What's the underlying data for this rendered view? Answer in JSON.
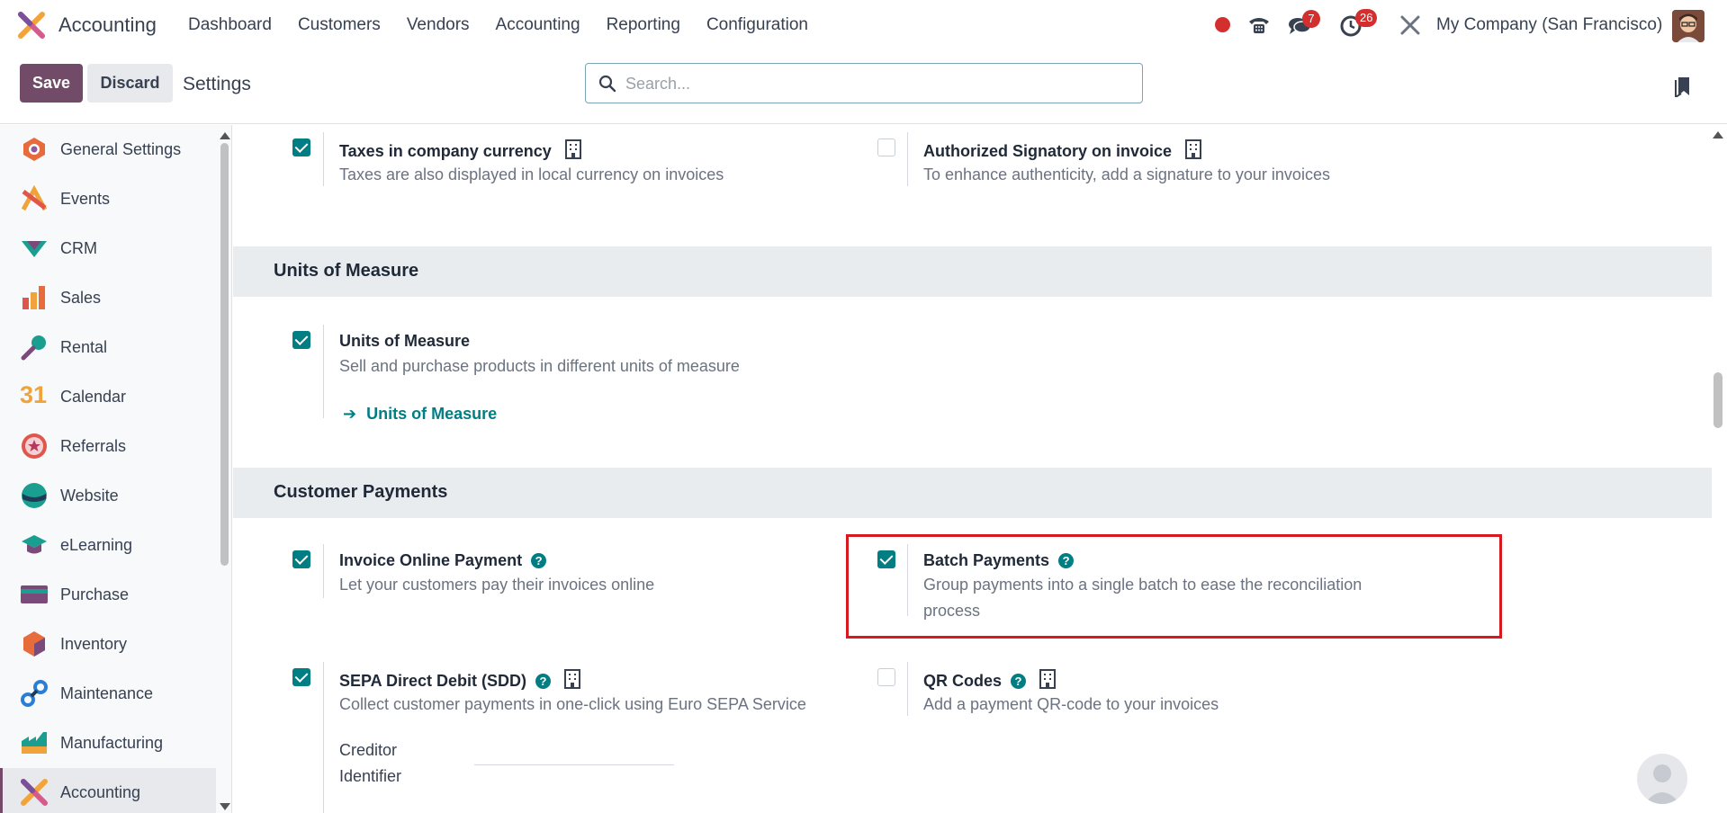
{
  "topbar": {
    "app_name": "Accounting",
    "menu": [
      "Dashboard",
      "Customers",
      "Vendors",
      "Accounting",
      "Reporting",
      "Configuration"
    ],
    "messages_count": "7",
    "activities_count": "26",
    "company": "My Company (San Francisco)"
  },
  "controlbar": {
    "save_label": "Save",
    "discard_label": "Discard",
    "breadcrumb": "Settings",
    "search_placeholder": "Search..."
  },
  "sidebar": {
    "items": [
      {
        "label": "General Settings",
        "icon": "general-settings-icon"
      },
      {
        "label": "Events",
        "icon": "events-icon"
      },
      {
        "label": "CRM",
        "icon": "crm-icon"
      },
      {
        "label": "Sales",
        "icon": "sales-icon"
      },
      {
        "label": "Rental",
        "icon": "rental-icon"
      },
      {
        "label": "Calendar",
        "icon": "calendar-icon"
      },
      {
        "label": "Referrals",
        "icon": "referrals-icon"
      },
      {
        "label": "Website",
        "icon": "website-icon"
      },
      {
        "label": "eLearning",
        "icon": "elearning-icon"
      },
      {
        "label": "Purchase",
        "icon": "purchase-icon"
      },
      {
        "label": "Inventory",
        "icon": "inventory-icon"
      },
      {
        "label": "Maintenance",
        "icon": "maintenance-icon"
      },
      {
        "label": "Manufacturing",
        "icon": "manufacturing-icon"
      },
      {
        "label": "Accounting",
        "icon": "accounting-icon",
        "active": true
      }
    ],
    "calendar_icon_text": "31"
  },
  "settings": {
    "taxes_currency": {
      "title": "Taxes in company currency",
      "desc": "Taxes are also displayed in local currency on invoices",
      "checked": true
    },
    "authorized_signatory": {
      "title": "Authorized Signatory on invoice",
      "desc": "To enhance authenticity, add a signature to your invoices",
      "checked": false
    },
    "uom_section": "Units of Measure",
    "uom": {
      "title": "Units of Measure",
      "desc": "Sell and purchase products in different units of measure",
      "link": "Units of Measure",
      "checked": true
    },
    "payments_section": "Customer Payments",
    "invoice_online_payment": {
      "title": "Invoice Online Payment",
      "desc": "Let your customers pay their invoices online",
      "checked": true
    },
    "batch_payments": {
      "title": "Batch Payments",
      "desc_line1": "Group payments into a single batch to ease the reconciliation",
      "desc_line2": "process",
      "checked": true
    },
    "sepa": {
      "title": "SEPA Direct Debit (SDD)",
      "desc": "Collect customer payments in one-click using Euro SEPA Service",
      "checked": true,
      "field_label_1": "Creditor",
      "field_label_2": "Identifier"
    },
    "qr_codes": {
      "title": "QR Codes",
      "desc": "Add a payment QR-code to your invoices",
      "checked": false
    }
  },
  "colors": {
    "brand": "#714b67",
    "accent": "#017e84",
    "highlight": "#d71920",
    "badge": "#d32f2f"
  }
}
